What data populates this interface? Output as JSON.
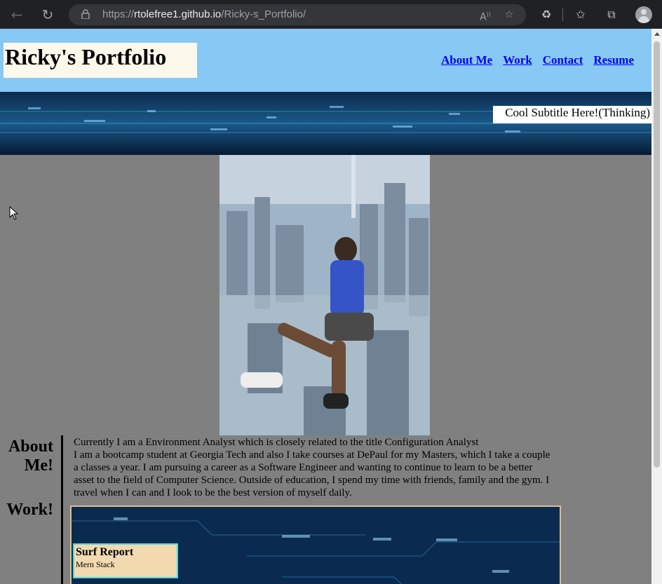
{
  "browser": {
    "url_prefix": "https://",
    "url_host": "rtolefree1.github.io",
    "url_path": "/Ricky-s_Portfolio/",
    "icons": [
      "back-icon",
      "reload-icon",
      "lock-icon",
      "read-aloud-icon",
      "add-favorite-icon",
      "extensions-icon",
      "favorites-icon",
      "collections-icon",
      "profile-icon"
    ]
  },
  "header": {
    "title": "Ricky's Portfolio",
    "nav": [
      "About Me",
      "Work",
      "Contact",
      "Resume"
    ]
  },
  "hero": {
    "subtitle": "Cool Subtitle Here!(Thinking)"
  },
  "sections": {
    "about_title_line1": "About",
    "about_title_line2": "Me!",
    "work_title": "Work!"
  },
  "about": {
    "line1": "Currently I am a Environment Analyst which is closely related to the title Configuration Analyst",
    "paragraph": "I am a bootcamp student at Georgia Tech and also I take courses at DePaul for my Masters, which I take a couple a classes a year. I am pursuing a career as a Software Engineer and wanting to continue to learn to be a better asset to the field of Computer Science. Outside of education, I spend my time with friends, family and the gym. I travel when I can and I look to be the best version of myself daily."
  },
  "work": {
    "cards": [
      {
        "title": "Surf Report",
        "subtitle": "Mern Stack"
      }
    ]
  },
  "colors": {
    "header_bg": "#87c9f4",
    "page_bg": "#808080",
    "link": "#0000ee",
    "card_bg": "#f2d9b0",
    "card_border": "#59d6e0"
  }
}
